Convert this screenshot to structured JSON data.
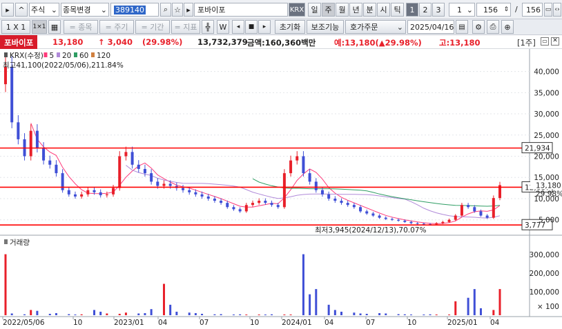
{
  "toolbar1": {
    "expand_label": "▸◻",
    "market_select": "주식",
    "stock_change": "종목변경",
    "code": "389140",
    "stock_name": "포바이포",
    "exchange": "KRX",
    "period_tabs": [
      "일",
      "주",
      "월",
      "년",
      "분",
      "시",
      "틱"
    ],
    "active_period": "주",
    "nums": [
      "1",
      "2",
      "3"
    ],
    "interval_value": "1",
    "count_value": "156",
    "slash": "/",
    "total_value": "156"
  },
  "toolbar2": {
    "view1": "1 X 1",
    "view2": "1×1",
    "item_label": "= 종목",
    "cycle_label": "= 주기",
    "period_label": "= 기간",
    "indicator_label": "= 지표",
    "reset": "초기화",
    "aux": "보조기능",
    "quote": "호가주문",
    "date": "2025/04/16"
  },
  "info": {
    "name": "포바이포",
    "price": "13,180",
    "change": "↑ 3,040",
    "rate": "(29.98%)",
    "volume": "13,732,379",
    "amount": "금액:160,360백만",
    "expected": "예:13,180(▲29.98%)",
    "high": "고:13,180",
    "period_tag": "[1주]"
  },
  "price_panel": {
    "legend": [
      "KRX(수정)",
      "5",
      "20",
      "60",
      "120"
    ],
    "legend_colors": [
      "#555555",
      "#ff3b7b",
      "#b08ad9",
      "#2e9d63",
      "#d08040"
    ],
    "high_note": "최고41,100(2022/05/06),211.84%",
    "low_note": "최저3,945(2024/12/13),70.07%",
    "y_ticks": [
      "40,000",
      "35,000",
      "30,000",
      "25,000",
      "20,000",
      "15,000",
      "10,000",
      "5,000"
    ],
    "level_labels": [
      "21,934",
      "12,687",
      "3,777"
    ],
    "last_price_tag": "13,180",
    "last_rate_tag": "29.98%"
  },
  "volume_panel": {
    "label": "거래량",
    "y_ticks": [
      "300,000",
      "200,000",
      "100,000",
      "× 100"
    ]
  },
  "x_axis": [
    "2022/05/06",
    "10",
    "2023/01",
    "04",
    "07",
    "10",
    "2024/01",
    "04",
    "07",
    "10",
    "2025/01",
    "04"
  ],
  "colors": {
    "up": "#e8202a",
    "down": "#3f4fd6",
    "support": "#ff0000",
    "accent": "#2f67c8"
  },
  "chart_data": {
    "type": "candlestick",
    "period": "weekly",
    "weeks": 156,
    "ylim": [
      3000,
      44000
    ],
    "high": {
      "value": 41100,
      "date": "2022/05/06"
    },
    "low": {
      "value": 3945,
      "date": "2024/12/13"
    },
    "last": 13180,
    "horizontal_lines": [
      21934,
      12687,
      3777
    ],
    "closes_approx": [
      41100,
      28000,
      24000,
      20000,
      26000,
      22000,
      19000,
      18000,
      16000,
      12000,
      11000,
      10500,
      11000,
      12000,
      11500,
      10800,
      11000,
      12500,
      20000,
      21000,
      18000,
      17000,
      16000,
      14000,
      13000,
      13500,
      13000,
      12500,
      12000,
      11500,
      11000,
      10500,
      10000,
      9500,
      9000,
      8000,
      7500,
      7000,
      8500,
      9000,
      9500,
      9000,
      8500,
      8000,
      16000,
      19000,
      20000,
      16000,
      14000,
      12000,
      11000,
      10000,
      9500,
      9000,
      8500,
      8000,
      7000,
      6500,
      6000,
      5500,
      5200,
      5000,
      4800,
      4500,
      4200,
      4100,
      4000,
      3945,
      4200,
      4500,
      5000,
      6000,
      8500,
      8000,
      7000,
      6000,
      5500,
      10140,
      13180
    ],
    "volume_hundreds_approx": [
      350000,
      10000,
      5000,
      30000,
      25000,
      8000,
      12000,
      6000,
      4000,
      5000,
      30000,
      20000,
      10000,
      8000,
      15000,
      10000,
      12000,
      35000,
      180000,
      60000,
      20000,
      15000,
      12000,
      8000,
      5000,
      6000,
      4000,
      5000,
      3000,
      4000,
      3000,
      5000,
      4000,
      3000,
      350000,
      120000,
      150000,
      60000,
      30000,
      20000,
      15000,
      10000,
      8000,
      12000,
      10000,
      6000,
      5000,
      4000,
      3000,
      5000,
      4000,
      3000,
      80000,
      100000,
      150000,
      40000,
      30000,
      150000
    ]
  }
}
